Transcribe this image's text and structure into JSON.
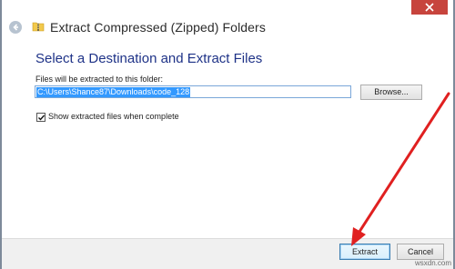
{
  "window": {
    "title": "Extract Compressed (Zipped) Folders"
  },
  "main": {
    "heading": "Select a Destination and Extract Files",
    "destination_label": "Files will be extracted to this folder:",
    "destination_path": "C:\\Users\\Shance87\\Downloads\\code_128",
    "browse_label": "Browse...",
    "show_files_checkbox": {
      "label": "Show extracted files when complete",
      "checked": true
    }
  },
  "footer": {
    "extract_label": "Extract",
    "cancel_label": "Cancel"
  },
  "watermark": "wsxdn.com",
  "colors": {
    "heading": "#1e3287",
    "close_button": "#c7443d",
    "selection": "#3399ff",
    "annotation_arrow": "#e02020"
  },
  "icons": [
    "back-arrow-icon",
    "folder-zip-icon",
    "close-icon",
    "checkmark-icon"
  ]
}
